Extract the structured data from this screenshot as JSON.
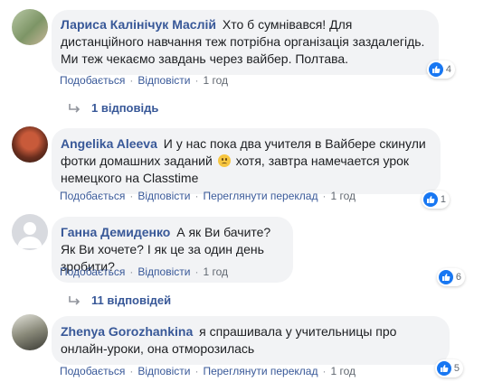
{
  "comments": [
    {
      "author": "Лариса Калінічук Маслій",
      "text": "Хто б сумнівався! Для дистанційного навчання теж потрібна організація заздалегідь. Ми теж чекаємо завдань через вайбер. Полтава.",
      "reactions": "4",
      "actions": {
        "like": "Подобається",
        "reply": "Відповісти",
        "time": "1 год"
      },
      "replies_label": "1 відповідь"
    },
    {
      "author": "Angelika Aleeva",
      "text_before": "И у нас пока два учителя в Вайбере скинули фотки домашних заданий",
      "text_after": "хотя, завтра намечается урок немецкого на Classtime",
      "emoji": "sad-face-emoji",
      "reactions": "1",
      "actions": {
        "like": "Подобається",
        "reply": "Відповісти",
        "translate": "Переглянути переклад",
        "time": "1 год"
      }
    },
    {
      "author": "Ганна Демиденко",
      "text": "А як Ви бачите? Як Ви хочете? І як це за один день зробити?",
      "reactions": "6",
      "actions": {
        "like": "Подобається",
        "reply": "Відповісти",
        "time": "1 год"
      },
      "replies_label": "11 відповідей"
    },
    {
      "author": "Zhenya Gorozhankina",
      "text": "я спрашивала у учительницы про онлайн-уроки, она отморозилась",
      "reactions": "5",
      "actions": {
        "like": "Подобається",
        "reply": "Відповісти",
        "translate": "Переглянути переклад",
        "time": "1 год"
      }
    }
  ],
  "colors": {
    "link": "#385898",
    "bubble": "#f2f3f5",
    "like": "#1877f2",
    "meta": "#606770"
  }
}
